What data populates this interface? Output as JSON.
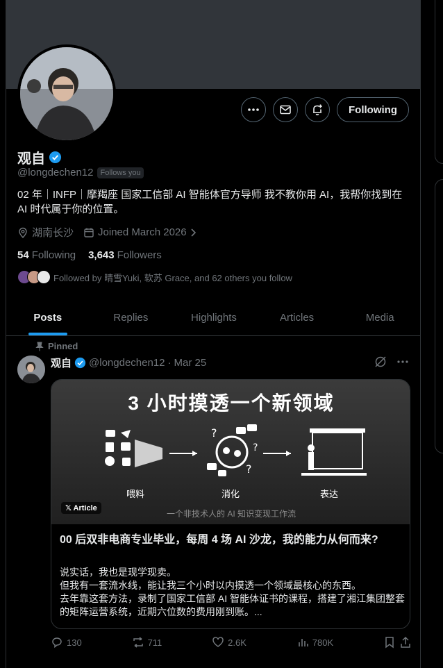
{
  "profile": {
    "name": "观自",
    "handle": "@longdechen12",
    "follows_you": "Follows you",
    "bio": "02 年｜INFP｜摩羯座 国家工信部 AI 智能体官方导师 我不教你用 AI，我帮你找到在 AI 时代属于你的位置。",
    "location": "湖南长沙",
    "joined": "Joined March 2026",
    "following_count": "54",
    "following_label": "Following",
    "followers_count": "3,643",
    "followers_label": "Followers",
    "followed_by": "Followed by 晴雪Yuki, 软苏 Grace, and 62 others you follow",
    "follow_button": "Following"
  },
  "tabs": [
    {
      "label": "Posts"
    },
    {
      "label": "Replies"
    },
    {
      "label": "Highlights"
    },
    {
      "label": "Articles"
    },
    {
      "label": "Media"
    }
  ],
  "post": {
    "pinned_label": "Pinned",
    "author": "观自",
    "handle": "@longdechen12",
    "date": "Mar 25",
    "card": {
      "image_title": "3 小时摸透一个新领域",
      "step1": "喂料",
      "step2": "消化",
      "step3": "表达",
      "image_caption": "一个非技术人的 AI 知识变现工作流",
      "badge": "Article",
      "headline": "00 后双非电商专业毕业，每周 4 场 AI 沙龙，我的能力从何而来?",
      "body": "说实话，我也是现学现卖。\n但我有一套流水线，能让我三个小时以内摸透一个领域最核心的东西。\n去年靠这套方法，录制了国家工信部 AI 智能体证书的课程，搭建了湘江集团整套的矩阵运营系统，近期六位数的费用刚到账。..."
    },
    "replies": "130",
    "reposts": "711",
    "likes": "2.6K",
    "views": "780K"
  },
  "colors": {
    "accent": "#1d9bf0",
    "verified": "#1d9bf0",
    "muted": "#71767b"
  }
}
